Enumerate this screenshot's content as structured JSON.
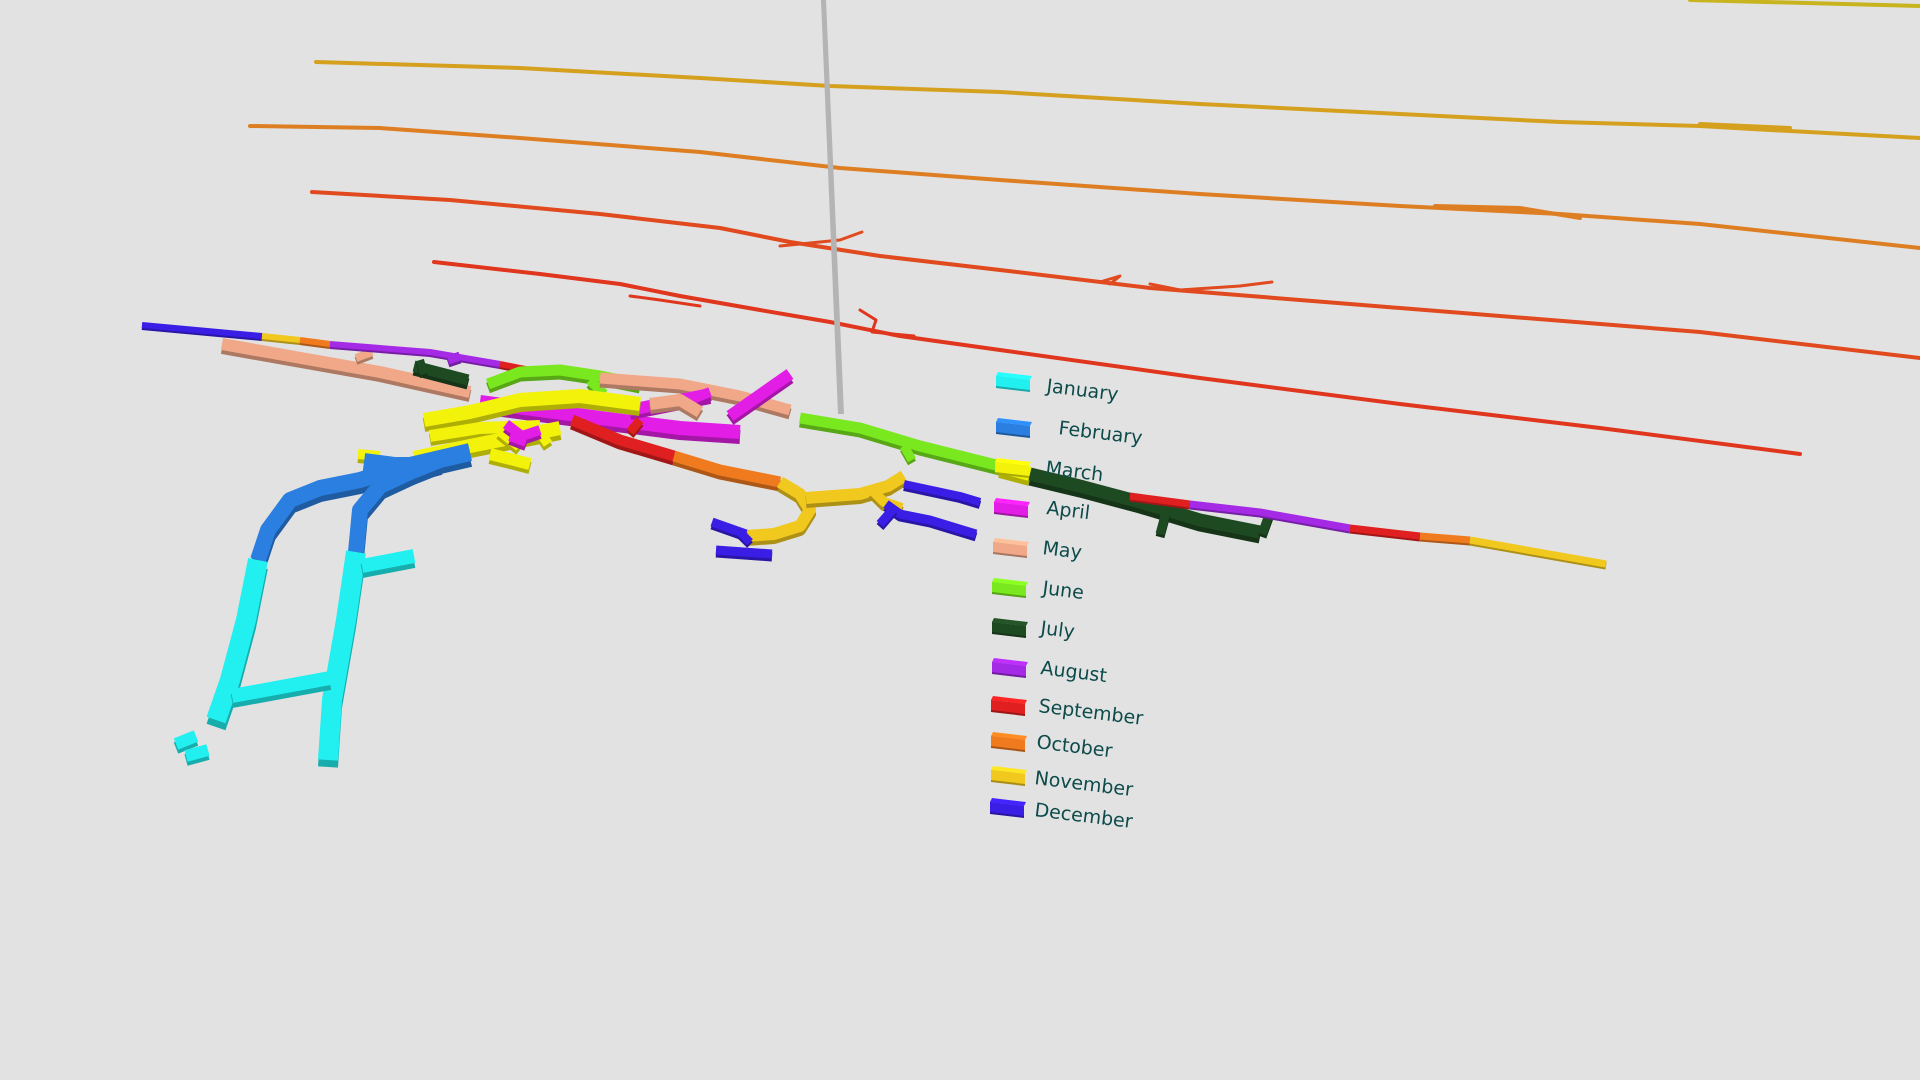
{
  "legend": {
    "items": [
      {
        "label": "January",
        "color": "#22f0f0"
      },
      {
        "label": "February",
        "color": "#2a7fe0"
      },
      {
        "label": "March",
        "color": "#f2f20a"
      },
      {
        "label": "April",
        "color": "#e21ee6"
      },
      {
        "label": "May",
        "color": "#f0a888"
      },
      {
        "label": "June",
        "color": "#7ae81e"
      },
      {
        "label": "July",
        "color": "#1e4a22"
      },
      {
        "label": "August",
        "color": "#a52ae6"
      },
      {
        "label": "September",
        "color": "#e02020"
      },
      {
        "label": "October",
        "color": "#f07a1e"
      },
      {
        "label": "November",
        "color": "#f0c81e"
      },
      {
        "label": "December",
        "color": "#3a1ee6"
      }
    ]
  },
  "colors": {
    "background": "#e2e2e2",
    "pole": "#b4b4b4",
    "level_lines": [
      "#c8b41e",
      "#d4a01e",
      "#de7e22",
      "#e04a1e",
      "#e0361e",
      "#e0281e"
    ]
  }
}
